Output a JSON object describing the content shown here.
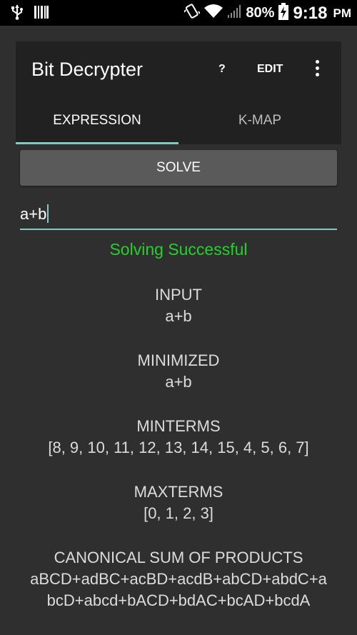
{
  "status_bar": {
    "battery": "80%",
    "time": "9:18",
    "ampm": "PM"
  },
  "app": {
    "title": "Bit Decrypter",
    "help_label": "?",
    "edit_label": "EDIT"
  },
  "tabs": [
    {
      "label": "EXPRESSION",
      "selected": true
    },
    {
      "label": "K-MAP",
      "selected": false
    }
  ],
  "solve_label": "SOLVE",
  "expression": {
    "value": "a+b"
  },
  "status_message": "Solving Successful",
  "results": {
    "input": {
      "label": "INPUT",
      "value": "a+b"
    },
    "minimized": {
      "label": "MINIMIZED",
      "value": "a+b"
    },
    "minterms": {
      "label": "MINTERMS",
      "value": "[8, 9, 10, 11, 12, 13, 14, 15, 4, 5, 6, 7]"
    },
    "maxterms": {
      "label": "MAXTERMS",
      "value": "[0, 1, 2, 3]"
    },
    "csop": {
      "label": "CANONICAL SUM OF PRODUCTS",
      "line1": "aBCD+adBC+acBD+acdB+abCD+abdC+a",
      "line2": "bcD+abcd+bACD+bdAC+bcAD+bcdA"
    }
  },
  "colors": {
    "accent": "#80cbc4",
    "success": "#22d22b",
    "background": "#2f2f2f",
    "toolbar": "#212121"
  }
}
